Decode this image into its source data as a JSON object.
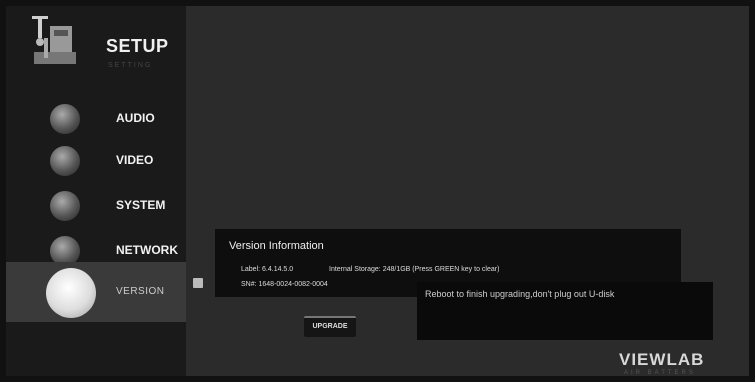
{
  "sidebar": {
    "title": "SETUP",
    "subtitle": "SETTING",
    "items": [
      {
        "label": "AUDIO",
        "icon": "audio-icon"
      },
      {
        "label": "VIDEO",
        "icon": "video-icon"
      },
      {
        "label": "SYSTEM",
        "icon": "system-icon"
      },
      {
        "label": "NETWORK",
        "icon": "network-icon"
      },
      {
        "label": "VERSION",
        "icon": "version-icon",
        "active": true
      }
    ]
  },
  "version_info": {
    "title": "Version Information",
    "label": "Label: 6.4.14.5.0",
    "storage": "Internal Storage: 248/1GB (Press GREEN key to clear)",
    "sn": "SN#: 1648-0024-0082-0004"
  },
  "message": "Reboot to finish upgrading,don't plug out U-disk",
  "upgrade_label": "UPGRADE",
  "brand": {
    "name": "VIEWLAB",
    "tagline": "AIR BATTERS"
  },
  "colors": {
    "background": "#2b2b2b",
    "sidebar": "#1a1a1a",
    "panel": "#0e0e0e",
    "active": "#3a3a3a"
  }
}
